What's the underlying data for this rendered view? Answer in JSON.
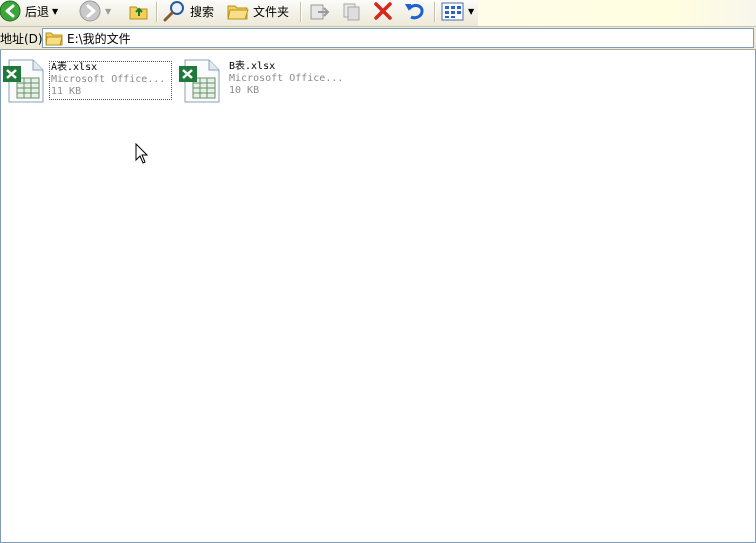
{
  "toolbar": {
    "back_label": "后退",
    "search_label": "搜索",
    "folders_label": "文件夹"
  },
  "address_bar": {
    "label": "地址(D)",
    "path": "E:\\我的文件"
  },
  "files": [
    {
      "name": "A表.xlsx",
      "type": "Microsoft Office...",
      "size": "11 KB",
      "selected": true
    },
    {
      "name": "B表.xlsx",
      "type": "Microsoft Office...",
      "size": "10 KB",
      "selected": false
    }
  ],
  "colors": {
    "excel_green": "#1d7a3a",
    "delete_red": "#d8261b",
    "undo_blue": "#1f5fcf"
  }
}
